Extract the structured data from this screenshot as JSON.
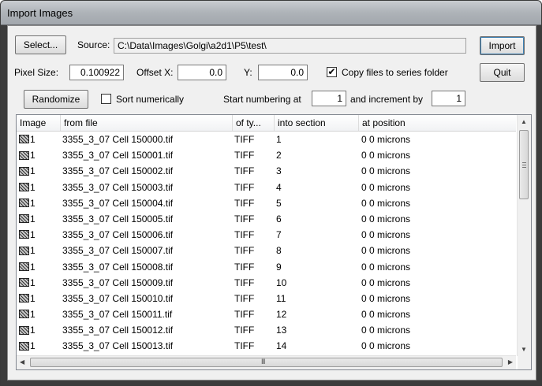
{
  "window": {
    "title": "Import Images"
  },
  "toolbar": {
    "select_label": "Select...",
    "source_label": "Source:",
    "source_value": "C:\\Data\\Images\\Golgi\\a2d1\\P5\\test\\",
    "import_label": "Import",
    "quit_label": "Quit",
    "pixel_size_label": "Pixel Size:",
    "pixel_size_value": "0.100922",
    "offset_x_label": "Offset X:",
    "offset_x_value": "0.0",
    "offset_y_label": "Y:",
    "offset_y_value": "0.0",
    "copy_files_label": "Copy files to series folder",
    "copy_files_checked": "✔",
    "randomize_label": "Randomize",
    "sort_label": "Sort numerically",
    "start_numbering_label": "Start numbering at",
    "start_numbering_value": "1",
    "increment_label": "and increment by",
    "increment_value": "1"
  },
  "table": {
    "columns": [
      "Image",
      "from file",
      "of ty...",
      "into section",
      "at position"
    ],
    "rows": [
      {
        "image": "1",
        "file": "3355_3_07 Cell 150000.tif",
        "type": "TIFF",
        "section": "1",
        "position": "0 0 microns"
      },
      {
        "image": "1",
        "file": "3355_3_07 Cell 150001.tif",
        "type": "TIFF",
        "section": "2",
        "position": "0 0 microns"
      },
      {
        "image": "1",
        "file": "3355_3_07 Cell 150002.tif",
        "type": "TIFF",
        "section": "3",
        "position": "0 0 microns"
      },
      {
        "image": "1",
        "file": "3355_3_07 Cell 150003.tif",
        "type": "TIFF",
        "section": "4",
        "position": "0 0 microns"
      },
      {
        "image": "1",
        "file": "3355_3_07 Cell 150004.tif",
        "type": "TIFF",
        "section": "5",
        "position": "0 0 microns"
      },
      {
        "image": "1",
        "file": "3355_3_07 Cell 150005.tif",
        "type": "TIFF",
        "section": "6",
        "position": "0 0 microns"
      },
      {
        "image": "1",
        "file": "3355_3_07 Cell 150006.tif",
        "type": "TIFF",
        "section": "7",
        "position": "0 0 microns"
      },
      {
        "image": "1",
        "file": "3355_3_07 Cell 150007.tif",
        "type": "TIFF",
        "section": "8",
        "position": "0 0 microns"
      },
      {
        "image": "1",
        "file": "3355_3_07 Cell 150008.tif",
        "type": "TIFF",
        "section": "9",
        "position": "0 0 microns"
      },
      {
        "image": "1",
        "file": "3355_3_07 Cell 150009.tif",
        "type": "TIFF",
        "section": "10",
        "position": "0 0 microns"
      },
      {
        "image": "1",
        "file": "3355_3_07 Cell 150010.tif",
        "type": "TIFF",
        "section": "11",
        "position": "0 0 microns"
      },
      {
        "image": "1",
        "file": "3355_3_07 Cell 150011.tif",
        "type": "TIFF",
        "section": "12",
        "position": "0 0 microns"
      },
      {
        "image": "1",
        "file": "3355_3_07 Cell 150012.tif",
        "type": "TIFF",
        "section": "13",
        "position": "0 0 microns"
      },
      {
        "image": "1",
        "file": "3355_3_07 Cell 150013.tif",
        "type": "TIFF",
        "section": "14",
        "position": "0 0 microns"
      }
    ]
  },
  "scroll": {
    "h_grip": "III"
  }
}
